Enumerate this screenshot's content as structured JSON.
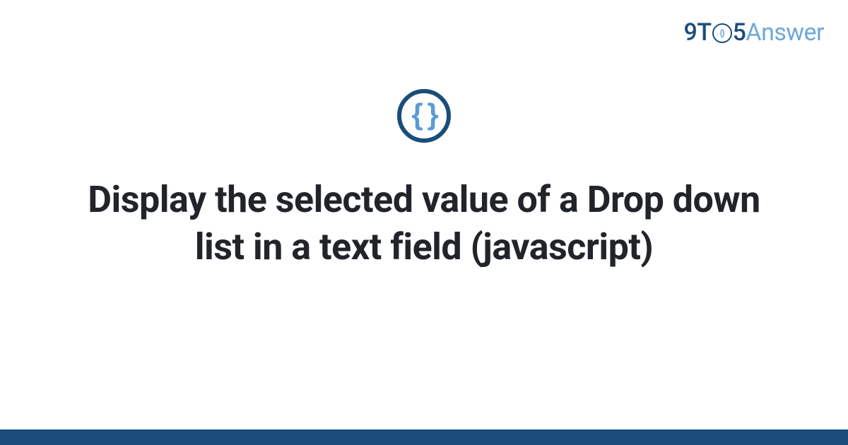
{
  "logo": {
    "part1": "9T",
    "circle_inner": "{}",
    "part2": "5",
    "part3": "Answer"
  },
  "icon": {
    "braces": "{ }"
  },
  "title": "Display the selected value of a Drop down list in a text field (javascript)",
  "colors": {
    "primary_dark": "#1a4d7a",
    "primary_light": "#6fa8d8",
    "text": "#212529"
  }
}
